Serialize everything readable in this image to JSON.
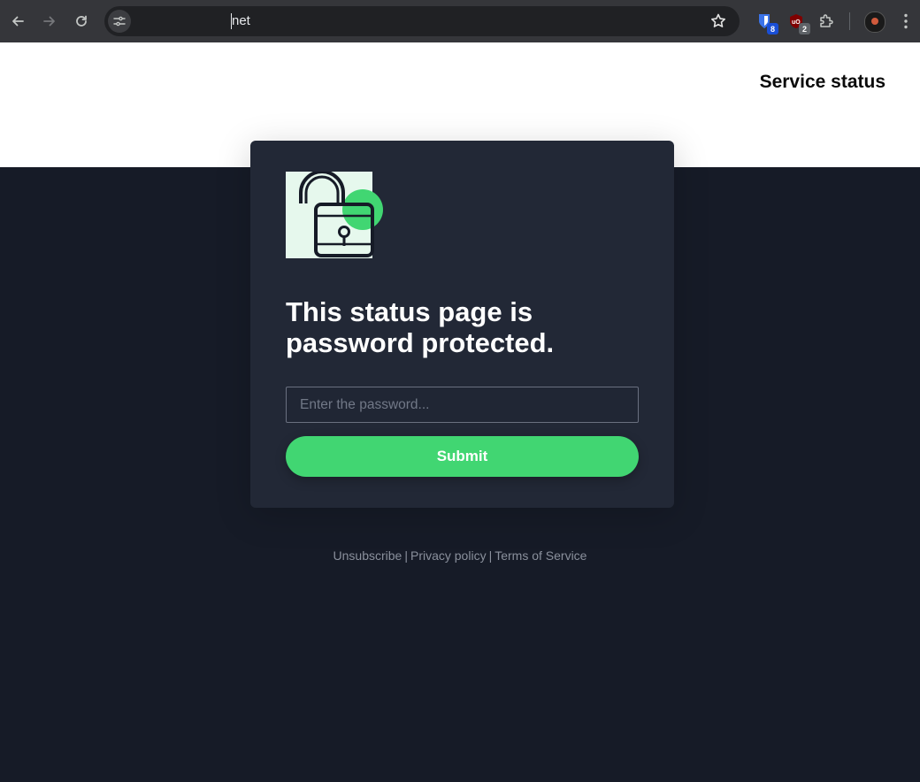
{
  "browser": {
    "url": "net",
    "extensions": [
      {
        "icon": "bitwarden-icon",
        "badge": "8",
        "badge_color": "#1a4fd6"
      },
      {
        "icon": "ublock-icon",
        "badge": "2",
        "badge_color": "#5f6368"
      }
    ]
  },
  "header": {
    "title": "Service status"
  },
  "card": {
    "title": "This status page is password protected.",
    "password_placeholder": "Enter the password...",
    "password_value": "",
    "submit_label": "Submit"
  },
  "footer": {
    "links": [
      "Unsubscribe",
      "Privacy policy",
      "Terms of Service"
    ],
    "separator": "|"
  },
  "colors": {
    "accent": "#41d672",
    "page_background": "#161b27",
    "card_background": "#222836",
    "header_background": "#ffffff"
  }
}
